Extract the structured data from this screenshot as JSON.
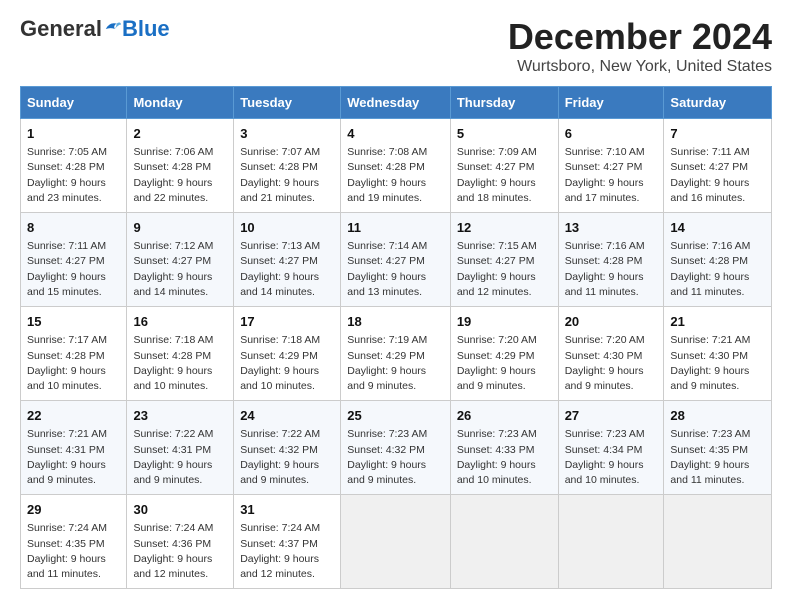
{
  "logo": {
    "general": "General",
    "blue": "Blue"
  },
  "title": "December 2024",
  "location": "Wurtsboro, New York, United States",
  "days_of_week": [
    "Sunday",
    "Monday",
    "Tuesday",
    "Wednesday",
    "Thursday",
    "Friday",
    "Saturday"
  ],
  "weeks": [
    [
      {
        "day": "1",
        "info": "Sunrise: 7:05 AM\nSunset: 4:28 PM\nDaylight: 9 hours\nand 23 minutes."
      },
      {
        "day": "2",
        "info": "Sunrise: 7:06 AM\nSunset: 4:28 PM\nDaylight: 9 hours\nand 22 minutes."
      },
      {
        "day": "3",
        "info": "Sunrise: 7:07 AM\nSunset: 4:28 PM\nDaylight: 9 hours\nand 21 minutes."
      },
      {
        "day": "4",
        "info": "Sunrise: 7:08 AM\nSunset: 4:28 PM\nDaylight: 9 hours\nand 19 minutes."
      },
      {
        "day": "5",
        "info": "Sunrise: 7:09 AM\nSunset: 4:27 PM\nDaylight: 9 hours\nand 18 minutes."
      },
      {
        "day": "6",
        "info": "Sunrise: 7:10 AM\nSunset: 4:27 PM\nDaylight: 9 hours\nand 17 minutes."
      },
      {
        "day": "7",
        "info": "Sunrise: 7:11 AM\nSunset: 4:27 PM\nDaylight: 9 hours\nand 16 minutes."
      }
    ],
    [
      {
        "day": "8",
        "info": "Sunrise: 7:11 AM\nSunset: 4:27 PM\nDaylight: 9 hours\nand 15 minutes."
      },
      {
        "day": "9",
        "info": "Sunrise: 7:12 AM\nSunset: 4:27 PM\nDaylight: 9 hours\nand 14 minutes."
      },
      {
        "day": "10",
        "info": "Sunrise: 7:13 AM\nSunset: 4:27 PM\nDaylight: 9 hours\nand 14 minutes."
      },
      {
        "day": "11",
        "info": "Sunrise: 7:14 AM\nSunset: 4:27 PM\nDaylight: 9 hours\nand 13 minutes."
      },
      {
        "day": "12",
        "info": "Sunrise: 7:15 AM\nSunset: 4:27 PM\nDaylight: 9 hours\nand 12 minutes."
      },
      {
        "day": "13",
        "info": "Sunrise: 7:16 AM\nSunset: 4:28 PM\nDaylight: 9 hours\nand 11 minutes."
      },
      {
        "day": "14",
        "info": "Sunrise: 7:16 AM\nSunset: 4:28 PM\nDaylight: 9 hours\nand 11 minutes."
      }
    ],
    [
      {
        "day": "15",
        "info": "Sunrise: 7:17 AM\nSunset: 4:28 PM\nDaylight: 9 hours\nand 10 minutes."
      },
      {
        "day": "16",
        "info": "Sunrise: 7:18 AM\nSunset: 4:28 PM\nDaylight: 9 hours\nand 10 minutes."
      },
      {
        "day": "17",
        "info": "Sunrise: 7:18 AM\nSunset: 4:29 PM\nDaylight: 9 hours\nand 10 minutes."
      },
      {
        "day": "18",
        "info": "Sunrise: 7:19 AM\nSunset: 4:29 PM\nDaylight: 9 hours\nand 9 minutes."
      },
      {
        "day": "19",
        "info": "Sunrise: 7:20 AM\nSunset: 4:29 PM\nDaylight: 9 hours\nand 9 minutes."
      },
      {
        "day": "20",
        "info": "Sunrise: 7:20 AM\nSunset: 4:30 PM\nDaylight: 9 hours\nand 9 minutes."
      },
      {
        "day": "21",
        "info": "Sunrise: 7:21 AM\nSunset: 4:30 PM\nDaylight: 9 hours\nand 9 minutes."
      }
    ],
    [
      {
        "day": "22",
        "info": "Sunrise: 7:21 AM\nSunset: 4:31 PM\nDaylight: 9 hours\nand 9 minutes."
      },
      {
        "day": "23",
        "info": "Sunrise: 7:22 AM\nSunset: 4:31 PM\nDaylight: 9 hours\nand 9 minutes."
      },
      {
        "day": "24",
        "info": "Sunrise: 7:22 AM\nSunset: 4:32 PM\nDaylight: 9 hours\nand 9 minutes."
      },
      {
        "day": "25",
        "info": "Sunrise: 7:23 AM\nSunset: 4:32 PM\nDaylight: 9 hours\nand 9 minutes."
      },
      {
        "day": "26",
        "info": "Sunrise: 7:23 AM\nSunset: 4:33 PM\nDaylight: 9 hours\nand 10 minutes."
      },
      {
        "day": "27",
        "info": "Sunrise: 7:23 AM\nSunset: 4:34 PM\nDaylight: 9 hours\nand 10 minutes."
      },
      {
        "day": "28",
        "info": "Sunrise: 7:23 AM\nSunset: 4:35 PM\nDaylight: 9 hours\nand 11 minutes."
      }
    ],
    [
      {
        "day": "29",
        "info": "Sunrise: 7:24 AM\nSunset: 4:35 PM\nDaylight: 9 hours\nand 11 minutes."
      },
      {
        "day": "30",
        "info": "Sunrise: 7:24 AM\nSunset: 4:36 PM\nDaylight: 9 hours\nand 12 minutes."
      },
      {
        "day": "31",
        "info": "Sunrise: 7:24 AM\nSunset: 4:37 PM\nDaylight: 9 hours\nand 12 minutes."
      },
      {
        "day": "",
        "info": ""
      },
      {
        "day": "",
        "info": ""
      },
      {
        "day": "",
        "info": ""
      },
      {
        "day": "",
        "info": ""
      }
    ]
  ]
}
